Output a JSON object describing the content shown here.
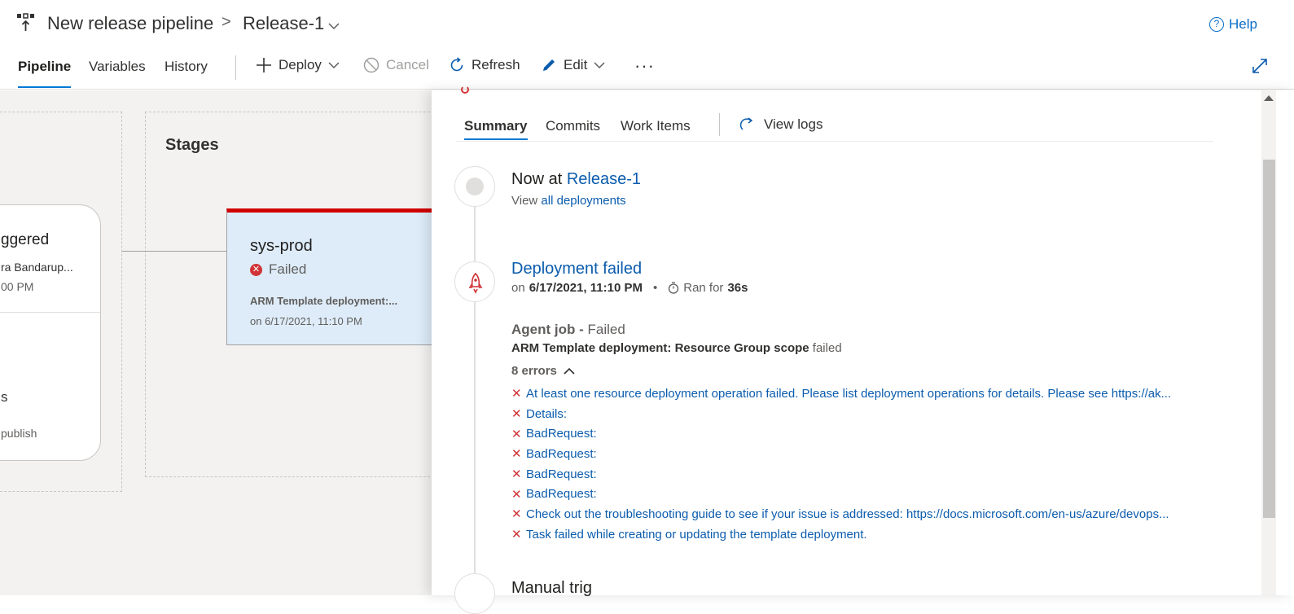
{
  "header": {
    "pipeline_name": "New release pipeline",
    "separator": ">",
    "release_name": "Release-1",
    "help_label": "Help",
    "help_glyph": "?"
  },
  "toolbar": {
    "tabs": [
      {
        "label": "Pipeline",
        "active": true
      },
      {
        "label": "Variables",
        "active": false
      },
      {
        "label": "History",
        "active": false
      }
    ],
    "deploy_label": "Deploy",
    "cancel_label": "Cancel",
    "refresh_label": "Refresh",
    "edit_label": "Edit",
    "more_label": "···"
  },
  "canvas": {
    "stages_label": "Stages",
    "trigger": {
      "title": "ggered",
      "by": "ra Bandarup...",
      "time": "00 PM",
      "source": "s",
      "branch": "publish"
    },
    "stage": {
      "name": "sys-prod",
      "status": "Failed",
      "task": "ARM Template deployment:...",
      "time": "on 6/17/2021, 11:10 PM"
    }
  },
  "panel": {
    "tabs": [
      {
        "label": "Summary",
        "active": true
      },
      {
        "label": "Commits",
        "active": false
      },
      {
        "label": "Work Items",
        "active": false
      }
    ],
    "view_logs_label": "View logs",
    "now_at_prefix": "Now at",
    "now_at_release": "Release-1",
    "view_prefix": "View",
    "view_all_link": "all deployments",
    "deployment_status": "Deployment failed",
    "on_prefix": "on",
    "deployment_time": "6/17/2021, 11:10 PM",
    "bullet": "•",
    "ran_for_prefix": "Ran for",
    "ran_for_value": "36s",
    "agent_job_label": "Agent job -",
    "agent_job_status": "Failed",
    "task_name": "ARM Template deployment: Resource Group scope",
    "task_status": "failed",
    "errors_count": "8 errors",
    "errors": [
      "At least one resource deployment operation failed. Please list deployment operations for details. Please see https://ak...",
      "Details:",
      "BadRequest:",
      "BadRequest:",
      "BadRequest:",
      "BadRequest:",
      "Check out the troubleshooting guide to see if your issue is addressed: https://docs.microsoft.com/en-us/azure/devops...",
      "Task failed while creating or updating the template deployment."
    ],
    "next_item": "Manual trig"
  },
  "colors": {
    "accent": "#0078d4",
    "link": "#0b5cad",
    "error": "#d13438",
    "stage_fail_bar": "#d00000",
    "stage_bg": "#deecf9"
  }
}
